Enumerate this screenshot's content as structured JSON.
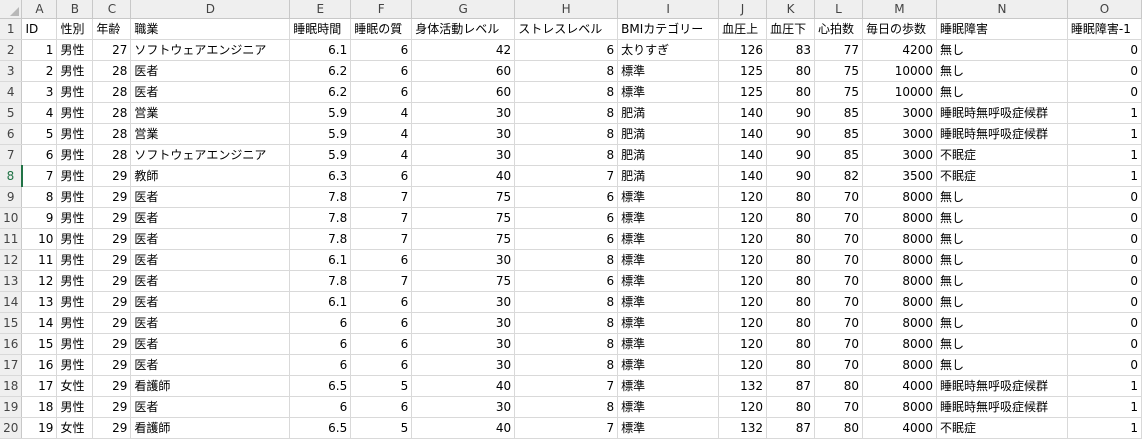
{
  "columns": [
    "A",
    "B",
    "C",
    "D",
    "E",
    "F",
    "G",
    "H",
    "I",
    "J",
    "K",
    "L",
    "M",
    "N",
    "O"
  ],
  "selected_row": 8,
  "header_row": {
    "row_label": "1",
    "cells": [
      "ID",
      "性別",
      "年齢",
      "職業",
      "睡眠時間",
      "睡眠の質",
      "身体活動レベル",
      "ストレスレベル",
      "BMIカテゴリー",
      "血圧上",
      "血圧下",
      "心拍数",
      "毎日の歩数",
      "睡眠障害",
      "睡眠障害-1"
    ]
  },
  "rows": [
    {
      "row_label": "2",
      "cells": [
        "1",
        "男性",
        "27",
        "ソフトウェアエンジニア",
        "6.1",
        "6",
        "42",
        "6",
        "太りすぎ",
        "126",
        "83",
        "77",
        "4200",
        "無し",
        "0"
      ]
    },
    {
      "row_label": "3",
      "cells": [
        "2",
        "男性",
        "28",
        "医者",
        "6.2",
        "6",
        "60",
        "8",
        "標準",
        "125",
        "80",
        "75",
        "10000",
        "無し",
        "0"
      ]
    },
    {
      "row_label": "4",
      "cells": [
        "3",
        "男性",
        "28",
        "医者",
        "6.2",
        "6",
        "60",
        "8",
        "標準",
        "125",
        "80",
        "75",
        "10000",
        "無し",
        "0"
      ]
    },
    {
      "row_label": "5",
      "cells": [
        "4",
        "男性",
        "28",
        "営業",
        "5.9",
        "4",
        "30",
        "8",
        "肥満",
        "140",
        "90",
        "85",
        "3000",
        "睡眠時無呼吸症候群",
        "1"
      ]
    },
    {
      "row_label": "6",
      "cells": [
        "5",
        "男性",
        "28",
        "営業",
        "5.9",
        "4",
        "30",
        "8",
        "肥満",
        "140",
        "90",
        "85",
        "3000",
        "睡眠時無呼吸症候群",
        "1"
      ]
    },
    {
      "row_label": "7",
      "cells": [
        "6",
        "男性",
        "28",
        "ソフトウェアエンジニア",
        "5.9",
        "4",
        "30",
        "8",
        "肥満",
        "140",
        "90",
        "85",
        "3000",
        "不眠症",
        "1"
      ]
    },
    {
      "row_label": "8",
      "cells": [
        "7",
        "男性",
        "29",
        "教師",
        "6.3",
        "6",
        "40",
        "7",
        "肥満",
        "140",
        "90",
        "82",
        "3500",
        "不眠症",
        "1"
      ]
    },
    {
      "row_label": "9",
      "cells": [
        "8",
        "男性",
        "29",
        "医者",
        "7.8",
        "7",
        "75",
        "6",
        "標準",
        "120",
        "80",
        "70",
        "8000",
        "無し",
        "0"
      ]
    },
    {
      "row_label": "10",
      "cells": [
        "9",
        "男性",
        "29",
        "医者",
        "7.8",
        "7",
        "75",
        "6",
        "標準",
        "120",
        "80",
        "70",
        "8000",
        "無し",
        "0"
      ]
    },
    {
      "row_label": "11",
      "cells": [
        "10",
        "男性",
        "29",
        "医者",
        "7.8",
        "7",
        "75",
        "6",
        "標準",
        "120",
        "80",
        "70",
        "8000",
        "無し",
        "0"
      ]
    },
    {
      "row_label": "12",
      "cells": [
        "11",
        "男性",
        "29",
        "医者",
        "6.1",
        "6",
        "30",
        "8",
        "標準",
        "120",
        "80",
        "70",
        "8000",
        "無し",
        "0"
      ]
    },
    {
      "row_label": "13",
      "cells": [
        "12",
        "男性",
        "29",
        "医者",
        "7.8",
        "7",
        "75",
        "6",
        "標準",
        "120",
        "80",
        "70",
        "8000",
        "無し",
        "0"
      ]
    },
    {
      "row_label": "14",
      "cells": [
        "13",
        "男性",
        "29",
        "医者",
        "6.1",
        "6",
        "30",
        "8",
        "標準",
        "120",
        "80",
        "70",
        "8000",
        "無し",
        "0"
      ]
    },
    {
      "row_label": "15",
      "cells": [
        "14",
        "男性",
        "29",
        "医者",
        "6",
        "6",
        "30",
        "8",
        "標準",
        "120",
        "80",
        "70",
        "8000",
        "無し",
        "0"
      ]
    },
    {
      "row_label": "16",
      "cells": [
        "15",
        "男性",
        "29",
        "医者",
        "6",
        "6",
        "30",
        "8",
        "標準",
        "120",
        "80",
        "70",
        "8000",
        "無し",
        "0"
      ]
    },
    {
      "row_label": "17",
      "cells": [
        "16",
        "男性",
        "29",
        "医者",
        "6",
        "6",
        "30",
        "8",
        "標準",
        "120",
        "80",
        "70",
        "8000",
        "無し",
        "0"
      ]
    },
    {
      "row_label": "18",
      "cells": [
        "17",
        "女性",
        "29",
        "看護師",
        "6.5",
        "5",
        "40",
        "7",
        "標準",
        "132",
        "87",
        "80",
        "4000",
        "睡眠時無呼吸症候群",
        "1"
      ]
    },
    {
      "row_label": "19",
      "cells": [
        "18",
        "男性",
        "29",
        "医者",
        "6",
        "6",
        "30",
        "8",
        "標準",
        "120",
        "80",
        "70",
        "8000",
        "睡眠時無呼吸症候群",
        "1"
      ]
    },
    {
      "row_label": "20",
      "cells": [
        "19",
        "女性",
        "29",
        "看護師",
        "6.5",
        "5",
        "40",
        "7",
        "標準",
        "132",
        "87",
        "80",
        "4000",
        "不眠症",
        "1"
      ]
    }
  ]
}
